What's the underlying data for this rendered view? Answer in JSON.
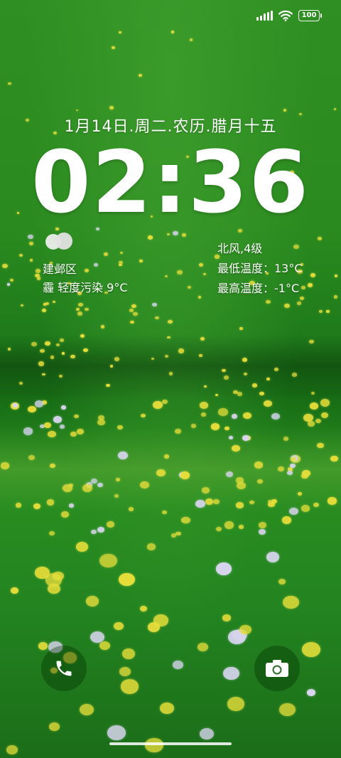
{
  "status_bar": {
    "battery_level": "100",
    "icons": [
      "signal-icon",
      "wifi-icon",
      "battery-icon"
    ]
  },
  "lockscreen": {
    "date": "1月14日.周二.农历.腊月十五",
    "time": "02:36"
  },
  "weather": {
    "icon": "cloudy-icon",
    "location": "建邺区",
    "condition": "霾  轻度污染  9°C",
    "wind": "北风,4级",
    "min_temp": "最低温度：13°C",
    "max_temp": "最高温度：-1°C"
  },
  "shortcuts": {
    "left_icon": "phone-icon",
    "right_icon": "camera-icon"
  },
  "colors": {
    "wallpaper_green": "#2a8a1f",
    "flower_yellow": "#e6de3a",
    "text": "#ffffff"
  }
}
